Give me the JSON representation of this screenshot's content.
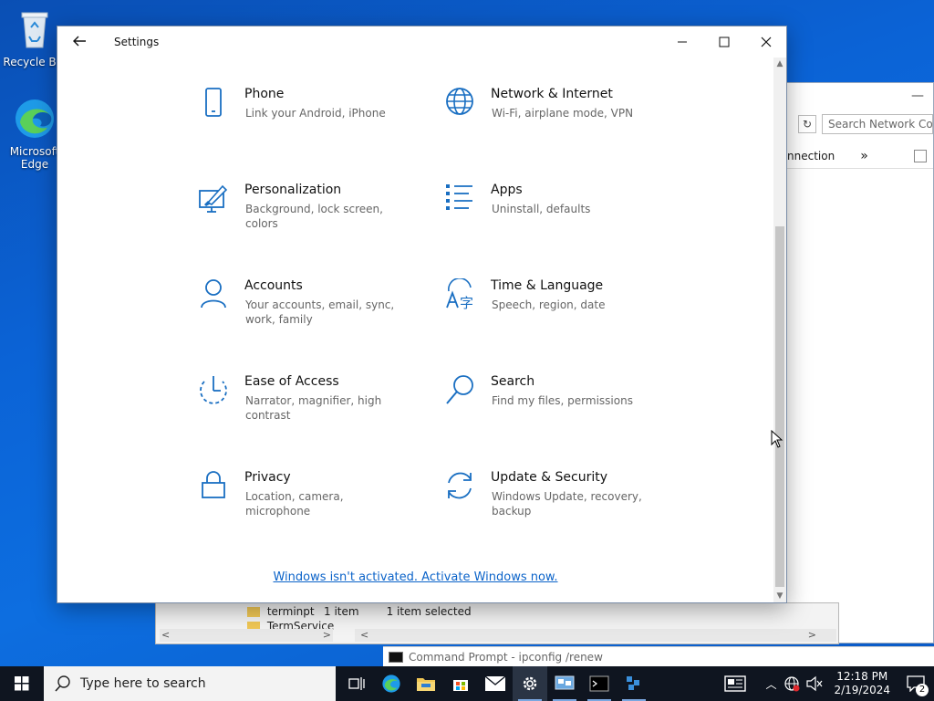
{
  "desktop": {
    "recycle_bin": "Recycle Bin",
    "edge": "Microsoft Edge"
  },
  "background_window": {
    "search_placeholder": "Search Network Con",
    "breadcrumb": "nnection",
    "more": "»",
    "folder_1": "terminpt",
    "folder_2": "TermService",
    "status_items": "1 item",
    "status_selected": "1 item selected"
  },
  "command_prompt": {
    "title": "Command Prompt - ipconfig /renew"
  },
  "settings": {
    "title": "Settings",
    "tiles": [
      {
        "name": "Phone",
        "desc": "Link your Android, iPhone",
        "icon": "phone-icon"
      },
      {
        "name": "Network & Internet",
        "desc": "Wi-Fi, airplane mode, VPN",
        "icon": "globe-icon"
      },
      {
        "name": "Personalization",
        "desc": "Background, lock screen, colors",
        "icon": "personalization-icon"
      },
      {
        "name": "Apps",
        "desc": "Uninstall, defaults",
        "icon": "apps-icon"
      },
      {
        "name": "Accounts",
        "desc": "Your accounts, email, sync, work, family",
        "icon": "person-icon"
      },
      {
        "name": "Time & Language",
        "desc": "Speech, region, date",
        "icon": "time-language-icon"
      },
      {
        "name": "Ease of Access",
        "desc": "Narrator, magnifier, high contrast",
        "icon": "ease-of-access-icon"
      },
      {
        "name": "Search",
        "desc": "Find my files, permissions",
        "icon": "search-icon"
      },
      {
        "name": "Privacy",
        "desc": "Location, camera, microphone",
        "icon": "lock-icon"
      },
      {
        "name": "Update & Security",
        "desc": "Windows Update, recovery, backup",
        "icon": "update-icon"
      }
    ],
    "activate_link": "Windows isn't activated. Activate Windows now."
  },
  "taskbar": {
    "search_placeholder": "Type here to search",
    "time": "12:18 PM",
    "date": "2/19/2024",
    "notification_count": "2"
  },
  "colors": {
    "accent": "#0b63c9",
    "icon_blue": "#1a6fc2",
    "taskbar": "#0f1520"
  }
}
